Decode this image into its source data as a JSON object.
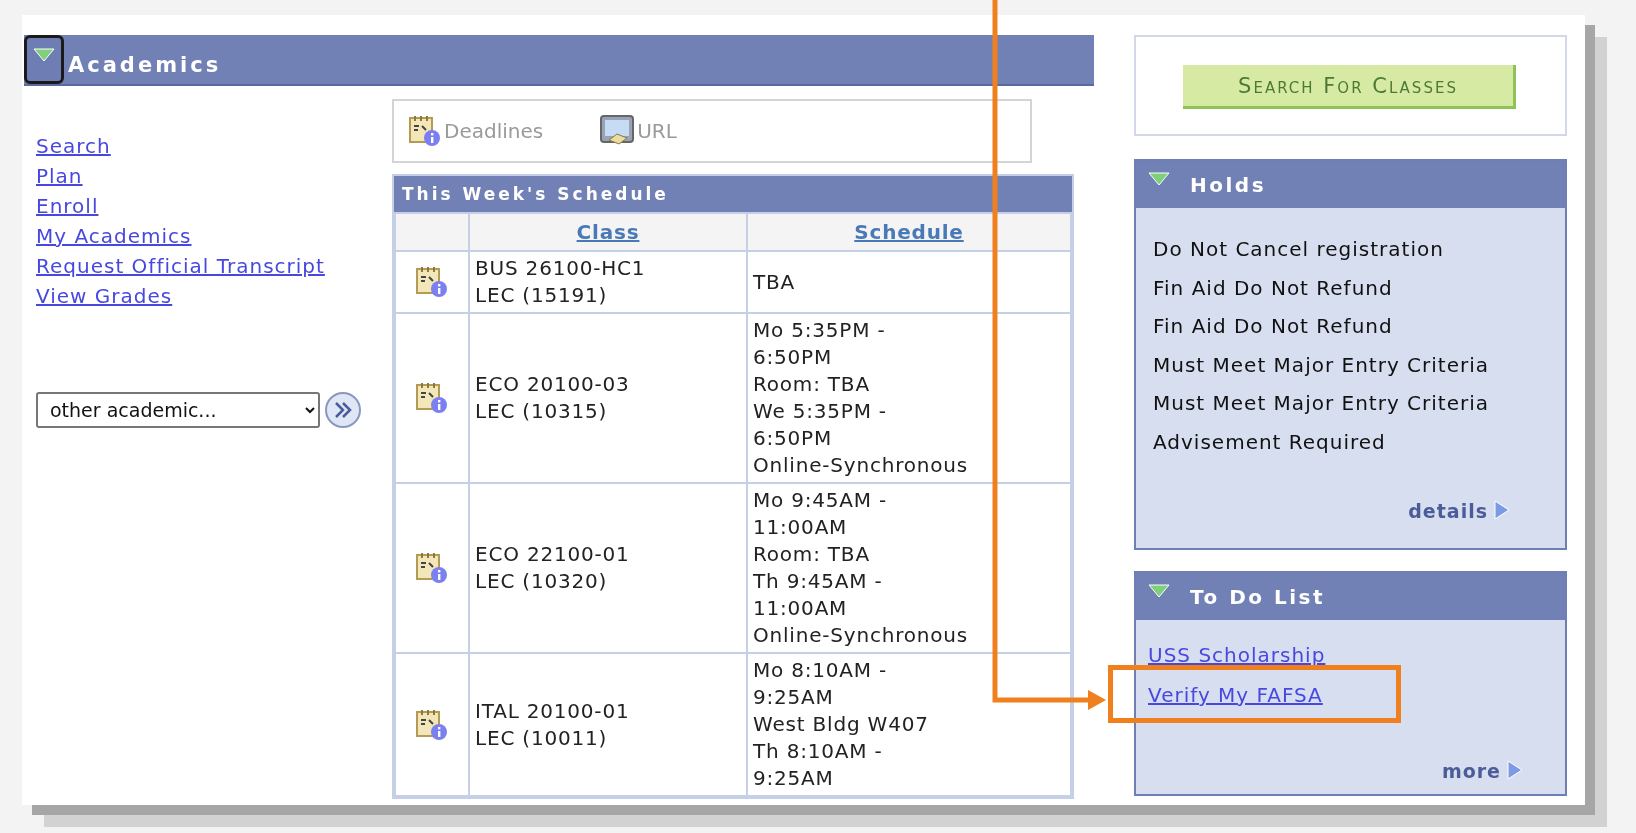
{
  "academics": {
    "title": "Academics",
    "expanded": true
  },
  "nav_links": [
    "Search",
    "Plan",
    "Enroll",
    "My Academics",
    "Request Official Transcript",
    "View Grades"
  ],
  "other_academic": {
    "value": "other academic..."
  },
  "toolbar": [
    {
      "label": "Deadlines",
      "kind": "deadlines"
    },
    {
      "label": "URL",
      "kind": "url"
    }
  ],
  "schedule": {
    "title": "This Week's Schedule",
    "columns": [
      "Class",
      "Schedule"
    ],
    "rows": [
      {
        "class": "BUS 26100-HC1\nLEC (15191)",
        "schedule": "TBA"
      },
      {
        "class": "ECO 20100-03\nLEC (10315)",
        "schedule": "Mo 5:35PM -\n6:50PM\nRoom:  TBA\nWe 5:35PM -\n6:50PM\nOnline-Synchronous"
      },
      {
        "class": "ECO 22100-01\nLEC (10320)",
        "schedule": "Mo 9:45AM -\n11:00AM\nRoom:  TBA\nTh 9:45AM -\n11:00AM\nOnline-Synchronous"
      },
      {
        "class": "ITAL 20100-01\nLEC (10011)",
        "schedule": "Mo 8:10AM -\n9:25AM\nWest Bldg W407\nTh 8:10AM -\n9:25AM"
      }
    ]
  },
  "search_button": "Search For Classes",
  "holds": {
    "title": "Holds",
    "expanded": true,
    "items": [
      "Do Not Cancel registration",
      "Fin Aid Do Not Refund",
      "Fin Aid Do Not Refund",
      "Must Meet Major Entry Criteria",
      "Must Meet Major Entry Criteria",
      "Advisement Required"
    ],
    "link": "details"
  },
  "todo": {
    "title": "To Do List",
    "expanded": true,
    "items": [
      {
        "label": "USS Scholarship",
        "highlighted": false
      },
      {
        "label": "Verify My FAFSA",
        "highlighted": true
      }
    ],
    "link": "more"
  }
}
